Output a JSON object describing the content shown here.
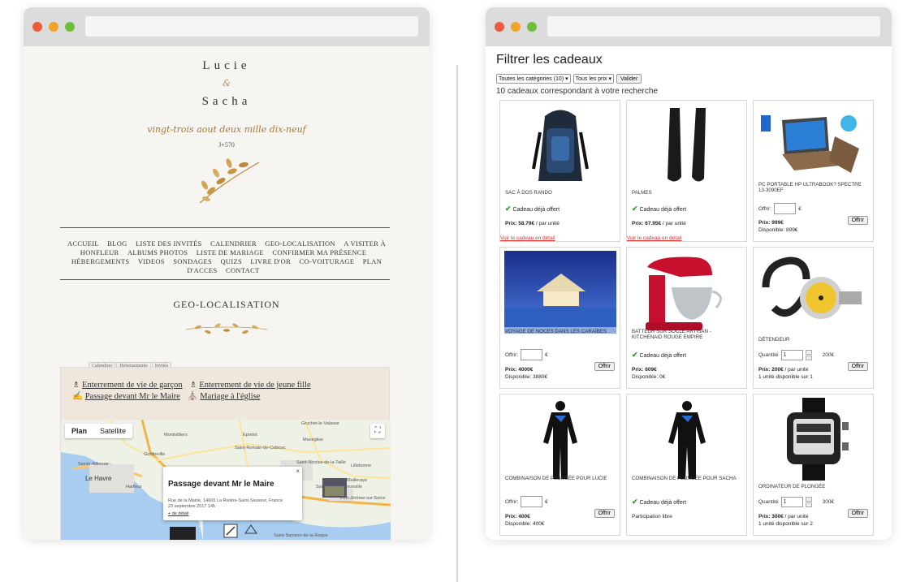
{
  "wedding": {
    "name1": "Lucie",
    "ampersand": "&",
    "name2": "Sacha",
    "date_script": "vingt-trois aout deux mille dix-neuf",
    "countdown": "J+570",
    "nav": [
      "ACCUEIL",
      "BLOG",
      "LISTE DES INVITÉS",
      "CALENDRIER",
      "GEO-LOCALISATION",
      "A VISITER À HONFLEUR",
      "ALBUMS PHOTOS",
      "LISTE DE MARIAGE",
      "CONFIRMER MA PRÉSENCE",
      "HÉBERGEMENTS",
      "VIDEOS",
      "SONDAGES",
      "QUIZS",
      "LIVRE D'OR",
      "CO-VOITURAGE",
      "PLAN D'ACCES",
      "CONTACT"
    ],
    "section_title": "GEO-LOCALISATION",
    "tabs": [
      "Calendrier",
      "Hebergements",
      "Invités"
    ],
    "links": [
      "Enterrement de vie de garçon",
      "Enterrement de vie de jeune fille",
      "Passage devant Mr le Maire",
      "Mariage à l'église"
    ],
    "map": {
      "plan_label": "Plan",
      "satellite_label": "Satellite",
      "popup_title": "Passage devant Mr le Maire",
      "popup_address": "Rue de la Mairie, 14600 La Rivière-Saint-Sauveur, France",
      "popup_date": "23 septembre 2017 14h",
      "popup_more": "+ de détail",
      "places": [
        "Gruchet-le-Valasse",
        "Montivilliers",
        "Epretot",
        "Saint-Romain-de-Colbosc",
        "Manéglise",
        "Sainte-Adresse",
        "Le Havre",
        "Saint-Nicolas-de-la-Taille",
        "Lillebonne",
        "Saint-Vigor-d'Ymonville",
        "Port-Jérôme-sur-Seine",
        "Saint-Samson-de-la-Roque",
        "Mailleraye",
        "Gonfreville",
        "Harfleur"
      ]
    }
  },
  "gifts": {
    "title": "Filtrer les cadeaux",
    "filter_category": "Toutes les catégories (10)",
    "filter_price": "Tous les prix",
    "validate_label": "Valider",
    "result_count": "10 cadeaux correspondant à votre recherche",
    "offer_label": "Offrir:",
    "currency": "€",
    "offer_button": "Offrir",
    "gift_offered": "Cadeau déjà offert",
    "detail_link": "Voir le cadeau en détail",
    "quantity_label": "Quantité",
    "items": [
      {
        "name": "Sac à dos rando",
        "price": "Prix: 58.79€",
        "per": " / par unité",
        "offered": true,
        "detail": true
      },
      {
        "name": "Palmes",
        "price": "Prix: 67.95€",
        "per": " / par unité",
        "offered": true,
        "detail": true
      },
      {
        "name": "PC portable HP Ultrabook? Spectre 13-3090ef",
        "price": "Prix: 999€",
        "avail": "Disponible: 899€"
      },
      {
        "name": "Voyage de noces dans les Caraïbes",
        "price": "Prix: 4000€",
        "avail": "Disponible: 3880€"
      },
      {
        "name": "Batteur sur socle Artisan - KitchenAid rouge empire",
        "price": "Prix: 609€",
        "avail": "Disponible: 0€",
        "offered": true
      },
      {
        "name": "Détendeur",
        "price": "Prix: 200€",
        "per": " / par unité",
        "avail": "1 unité disponible sur 1",
        "qty": "1",
        "unit_price": "200€"
      },
      {
        "name": "Combinaison de plongée pour Lucie",
        "price": "Prix: 400€",
        "avail": "Disponible: 400€"
      },
      {
        "name": "Combinaison de plongée pour Sacha",
        "avail": "Participation libre",
        "offered": true
      },
      {
        "name": "Ordinateur de plongée",
        "price": "Prix: 300€",
        "per": " / par unité",
        "avail": "1 unité disponible sur 2",
        "qty": "1",
        "unit_price": "300€"
      }
    ]
  }
}
